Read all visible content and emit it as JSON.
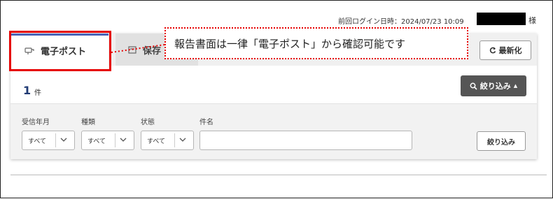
{
  "header": {
    "last_login": "前回ログイン日時：2024/07/23 10:09",
    "honorific": "様"
  },
  "tabs": [
    {
      "label": "電子ポスト",
      "icon": "mailbox-icon",
      "active": true
    },
    {
      "label": "保存",
      "icon": "archive-icon",
      "active": false
    }
  ],
  "toolbar": {
    "refresh_label": "最新化"
  },
  "results": {
    "count": "1",
    "unit": "件"
  },
  "filter": {
    "toggle_label": "絞り込み",
    "toggle_caret": "▲",
    "fields": [
      {
        "label": "受信年月",
        "value": "すべて"
      },
      {
        "label": "種類",
        "value": "すべて"
      },
      {
        "label": "状態",
        "value": "すべて"
      }
    ],
    "name_label": "件名",
    "name_value": "",
    "apply_label": "絞り込み"
  },
  "annotation": {
    "text": "報告書面は一律「電子ポスト」から確認可能です",
    "color": "#e60000"
  },
  "colors": {
    "active_tab_border": "#4a64b8",
    "count_text": "#1f3a73",
    "toggle_bg": "#555555"
  }
}
